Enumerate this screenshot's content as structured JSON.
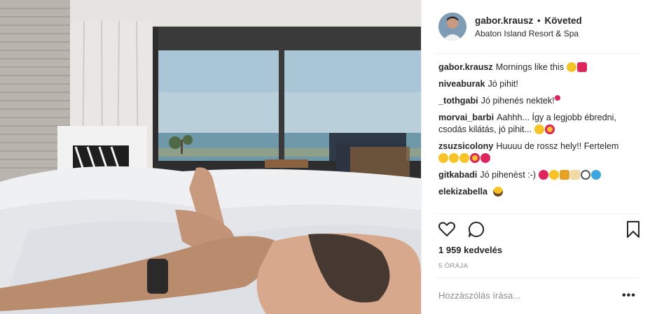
{
  "post": {
    "username": "gabor.krausz",
    "separator": "•",
    "follow_status": "Követed",
    "location": "Abaton Island Resort & Spa"
  },
  "comments": [
    {
      "user": "gabor.krausz",
      "text": "Mornings like this",
      "emojis": [
        "sun",
        "heart"
      ]
    },
    {
      "user": "niveaburak",
      "text": "Jó pihit!",
      "emojis": []
    },
    {
      "user": "_tothgabi",
      "text": "Jó pihenés nektek!",
      "emojis": [
        "heart"
      ]
    },
    {
      "user": "morvai_barbi",
      "text": "Aahhh... Így a legjobb ébredni, csodás kilátás, jó pihit...",
      "emojis": [
        "smile",
        "heart-eyes"
      ]
    },
    {
      "user": "zsuzsicolony",
      "text": "Huuuu de rossz hely!! Fertelem",
      "emojis": [
        "grin",
        "grin",
        "grin",
        "heart-eyes",
        "kiss"
      ]
    },
    {
      "user": "gitkabadi",
      "text": "Jó pihenèst :-)",
      "emojis": [
        "kiss",
        "sun",
        "trophy",
        "ice-cream",
        "magnifier",
        "droplets"
      ]
    },
    {
      "user": "elekizabella",
      "text": "",
      "emojis": [
        "scream"
      ]
    }
  ],
  "actions": {
    "like_icon": "heart-outline-icon",
    "comment_icon": "comment-bubble-icon",
    "save_icon": "bookmark-icon"
  },
  "likes": "1 959 kedvelés",
  "timestamp": "5 ÓRÁJA",
  "comment_box": {
    "placeholder": "Hozzászólás írása...",
    "more": "•••"
  },
  "colors": {
    "text": "#262626",
    "muted": "#8e8e8e",
    "divider": "#efefef",
    "emoji_yellow": "#f7c325",
    "emoji_red": "#e0245e"
  }
}
